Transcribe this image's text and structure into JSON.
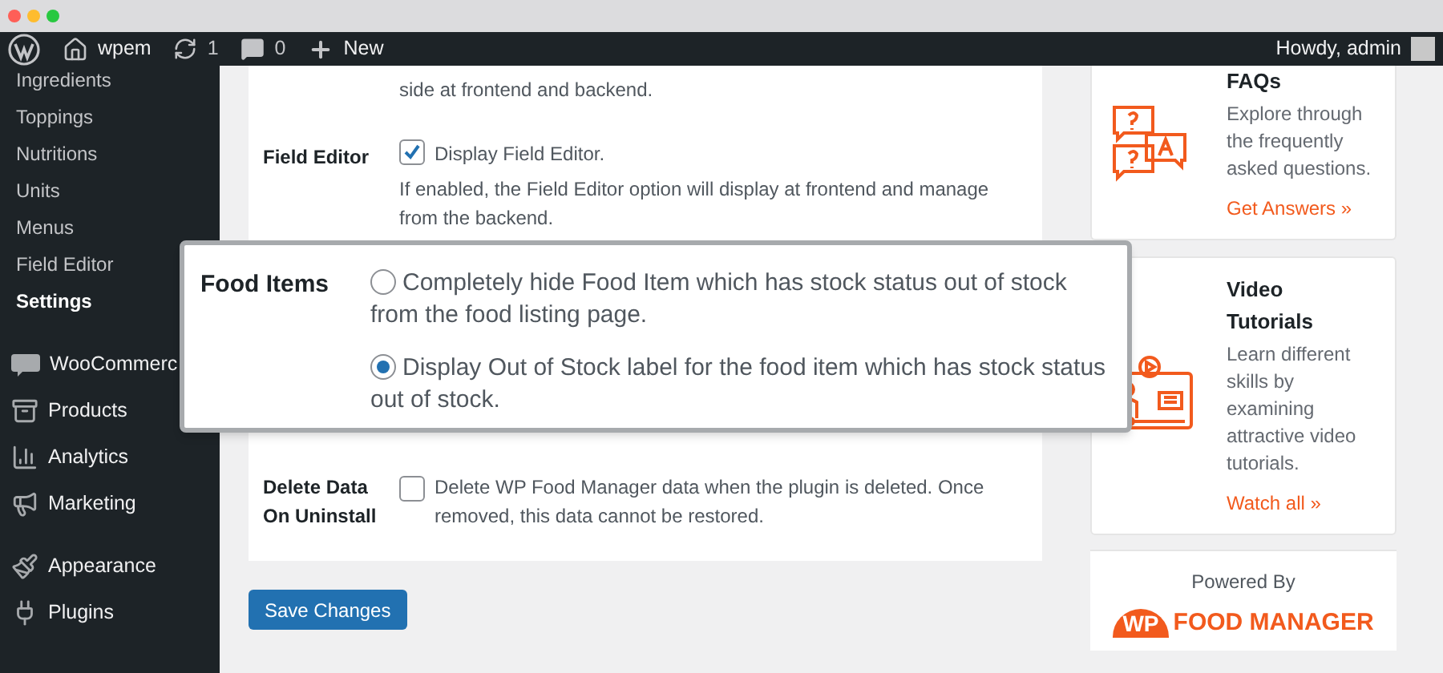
{
  "admin_bar": {
    "items": [
      {
        "kind": "logo"
      },
      {
        "kind": "site",
        "label": "wpem"
      },
      {
        "kind": "updates",
        "label": "1"
      },
      {
        "kind": "comments",
        "label": "0"
      },
      {
        "kind": "new",
        "label": "New"
      }
    ],
    "greeting": "Howdy, admin"
  },
  "sidebar": {
    "submenu": [
      {
        "label": "Ingredients",
        "selected": false
      },
      {
        "label": "Toppings",
        "selected": false
      },
      {
        "label": "Nutritions",
        "selected": false
      },
      {
        "label": "Units",
        "selected": false
      },
      {
        "label": "Menus",
        "selected": false
      },
      {
        "label": "Field Editor",
        "selected": false
      },
      {
        "label": "Settings",
        "selected": true
      }
    ],
    "menu": [
      {
        "kind": "woo",
        "label": "WooCommerc"
      },
      {
        "kind": "products",
        "label": "Products"
      },
      {
        "kind": "analytics",
        "label": "Analytics"
      },
      {
        "kind": "marketing",
        "label": "Marketing"
      },
      {
        "kind": "appearance",
        "label": "Appearance"
      },
      {
        "kind": "plugins",
        "label": "Plugins"
      }
    ]
  },
  "settings": {
    "intro": "side at frontend and backend.",
    "field_editor": {
      "label": "Field Editor",
      "checkbox_label": "Display Field Editor.",
      "checked": true,
      "description": "If enabled, the Field Editor option will display at frontend and manage from the backend."
    },
    "food_items": {
      "label": "Food Items",
      "options": [
        {
          "label": "Completely hide Food Item which has stock status out of stock from the food listing page.",
          "selected": false
        },
        {
          "label": "Display Out of Stock label for the food item which has stock status out of stock.",
          "selected": true
        }
      ]
    },
    "delete_data": {
      "label": "Delete Data On Uninstall",
      "checkbox_label": "Delete WP Food Manager data when the plugin is deleted. Once removed, this data cannot be restored.",
      "checked": false
    },
    "save_button": "Save Changes"
  },
  "help": {
    "cards": [
      {
        "kind": "faq",
        "title": "FAQs",
        "text": "Explore through the frequently asked questions.",
        "link": "Get Answers »"
      },
      {
        "kind": "video",
        "title": "Video Tutorials",
        "text": "Learn different skills by examining attractive video tutorials.",
        "link": "Watch all »"
      }
    ],
    "powered_by": "Powered By",
    "logo": {
      "mark": "WP",
      "name": "FOOD MANAGER"
    }
  }
}
